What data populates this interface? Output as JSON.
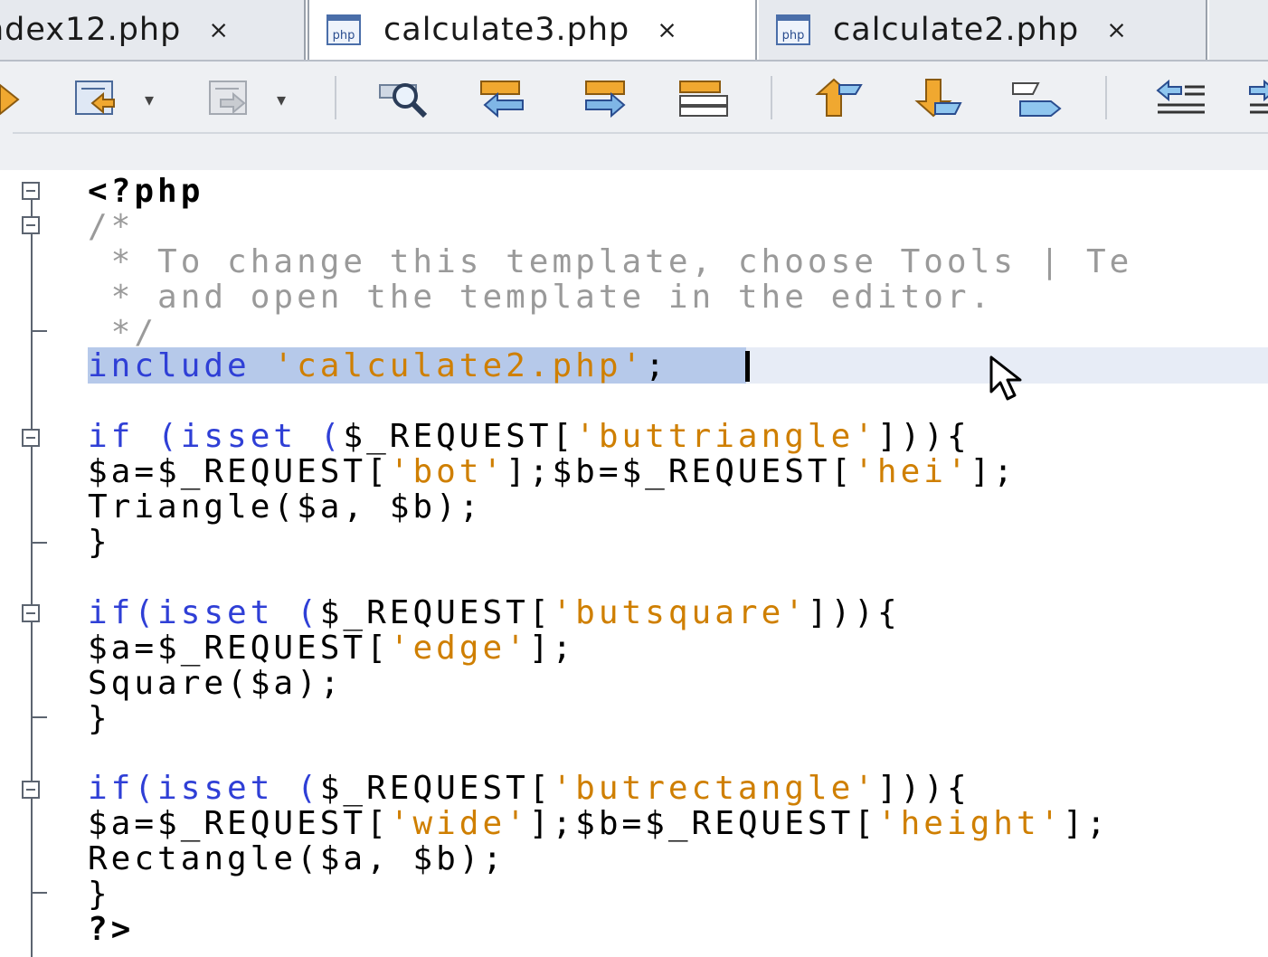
{
  "tabs": [
    {
      "label": "ndex12.php",
      "close": "×",
      "active": false
    },
    {
      "label": "calculate3.php",
      "close": "×",
      "active": true
    },
    {
      "label": "calculate2.php",
      "close": "×",
      "active": false
    }
  ],
  "tab_icon_text": "php",
  "toolbar": {
    "icons": [
      "back-arrow-icon",
      "last-edit-icon",
      "forward-icon",
      "find-icon",
      "find-previous-icon",
      "find-next-icon",
      "toggle-highlight-icon",
      "previous-bookmark-icon",
      "next-bookmark-icon",
      "toggle-bookmark-icon",
      "shift-left-icon",
      "shift-right-icon"
    ],
    "dropdown_glyph": "▾"
  },
  "editor": {
    "lines": {
      "l1": "<?php",
      "l2": "/*",
      "l3": " * To change this template, choose Tools | Te",
      "l4": " * and open the template in the editor.",
      "l5": " */",
      "l6_kw": "include",
      "l6_str": "'calculate2.php'",
      "l6_end": ";",
      "b1_l1_kw": "if (isset (",
      "b1_l1_mid": "$_REQUEST[",
      "b1_l1_str": "'buttriangle'",
      "b1_l1_end": "])){",
      "b1_l2_a": "$a=$_REQUEST[",
      "b1_l2_s1": "'bot'",
      "b1_l2_b": "];$b=$_REQUEST[",
      "b1_l2_s2": "'hei'",
      "b1_l2_c": "];",
      "b1_l3": "Triangle($a, $b);",
      "b1_l4": "}",
      "b2_l1_kw": "if(isset (",
      "b2_l1_mid": "$_REQUEST[",
      "b2_l1_str": "'butsquare'",
      "b2_l1_end": "])){",
      "b2_l2_a": "$a=$_REQUEST[",
      "b2_l2_s1": "'edge'",
      "b2_l2_b": "];",
      "b2_l3": "Square($a);",
      "b2_l4": "}",
      "b3_l1_kw": "if(isset (",
      "b3_l1_mid": "$_REQUEST[",
      "b3_l1_str": "'butrectangle'",
      "b3_l1_end": "])){",
      "b3_l2_a": "$a=$_REQUEST[",
      "b3_l2_s1": "'wide'",
      "b3_l2_b": "];$b=$_REQUEST[",
      "b3_l2_s2": "'height'",
      "b3_l2_c": "];",
      "b3_l3": "Rectangle($a, $b);",
      "b3_l4": "}",
      "end": "?>"
    }
  },
  "colors": {
    "keyword": "#2f3fd6",
    "string": "#cf7f00",
    "comment": "#9a9a9a",
    "selection": "#b6c9ea",
    "current_line": "#e7ecf6"
  }
}
